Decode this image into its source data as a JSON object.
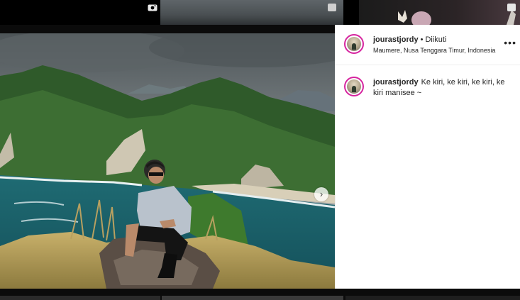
{
  "post": {
    "username": "jourastjordy",
    "separator": "•",
    "follow_status": "Diikuti",
    "location": "Maumere, Nusa Tenggara Timur, Indonesia",
    "caption_username": "jourastjordy",
    "caption": "Ke kiri, ke kiri, ke kiri, ke kiri manisee ~"
  },
  "icons": {
    "more": "more-options-icon",
    "next": "chevron-right-icon",
    "thumb_video": "video-icon",
    "thumb_multi": "multiple-photos-icon"
  },
  "colors": {
    "avatar_ring": "#d6249f",
    "text": "#262626",
    "divider": "#efefef"
  }
}
